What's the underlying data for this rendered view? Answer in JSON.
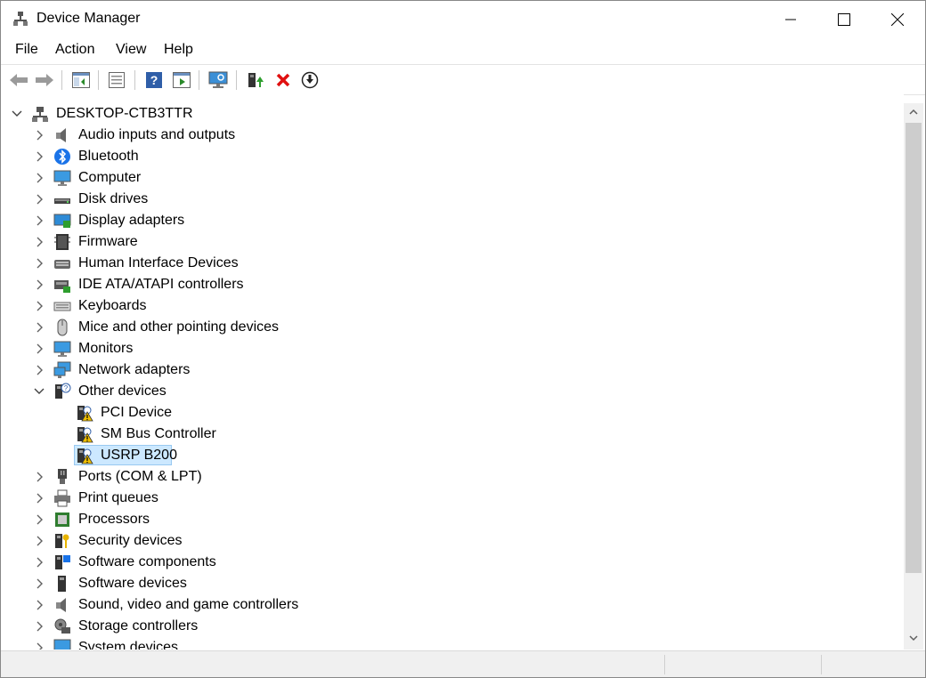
{
  "window": {
    "title": "Device Manager"
  },
  "menu": [
    {
      "label": "File"
    },
    {
      "label": "Action"
    },
    {
      "label": "View"
    },
    {
      "label": "Help"
    }
  ],
  "toolbar": {
    "buttons": [
      {
        "icon": "back-arrow-icon"
      },
      {
        "icon": "forward-arrow-icon"
      },
      {
        "icon": "show-hide-console-tree-icon"
      },
      {
        "icon": "properties-icon"
      },
      {
        "icon": "help-icon"
      },
      {
        "icon": "run-action-icon"
      },
      {
        "icon": "scan-hardware-changes-icon"
      },
      {
        "icon": "update-driver-icon"
      },
      {
        "icon": "uninstall-device-icon"
      },
      {
        "icon": "download-driver-icon"
      }
    ]
  },
  "tree": {
    "root": {
      "label": "DESKTOP-CTB3TTR",
      "icon": "computer-network-icon",
      "expanded": true
    },
    "categories": [
      {
        "label": "Audio inputs and outputs",
        "icon": "speaker-icon"
      },
      {
        "label": "Bluetooth",
        "icon": "bluetooth-icon"
      },
      {
        "label": "Computer",
        "icon": "monitor-icon"
      },
      {
        "label": "Disk drives",
        "icon": "disk-drive-icon"
      },
      {
        "label": "Display adapters",
        "icon": "display-adapter-icon"
      },
      {
        "label": "Firmware",
        "icon": "chip-icon"
      },
      {
        "label": "Human Interface Devices",
        "icon": "hid-icon"
      },
      {
        "label": "IDE ATA/ATAPI controllers",
        "icon": "ide-controller-icon"
      },
      {
        "label": "Keyboards",
        "icon": "keyboard-icon"
      },
      {
        "label": "Mice and other pointing devices",
        "icon": "mouse-icon"
      },
      {
        "label": "Monitors",
        "icon": "monitor-icon"
      },
      {
        "label": "Network adapters",
        "icon": "network-adapter-icon"
      },
      {
        "label": "Other devices",
        "icon": "unknown-device-icon",
        "expanded": true,
        "children": [
          {
            "label": "PCI Device",
            "icon": "warning-device-icon"
          },
          {
            "label": "SM Bus Controller",
            "icon": "warning-device-icon"
          },
          {
            "label": "USRP B200",
            "icon": "warning-device-icon",
            "selected": true
          }
        ]
      },
      {
        "label": "Ports (COM & LPT)",
        "icon": "port-icon"
      },
      {
        "label": "Print queues",
        "icon": "printer-icon"
      },
      {
        "label": "Processors",
        "icon": "processor-icon"
      },
      {
        "label": "Security devices",
        "icon": "security-key-icon"
      },
      {
        "label": "Software components",
        "icon": "software-component-icon"
      },
      {
        "label": "Software devices",
        "icon": "software-device-icon"
      },
      {
        "label": "Sound, video and game controllers",
        "icon": "speaker-icon"
      },
      {
        "label": "Storage controllers",
        "icon": "storage-controller-icon"
      },
      {
        "label": "System devices",
        "icon": "system-device-icon"
      }
    ]
  },
  "colors": {
    "selection": "#cce8ff",
    "selection_border": "#99c9f1",
    "accent": "#0078d7"
  }
}
